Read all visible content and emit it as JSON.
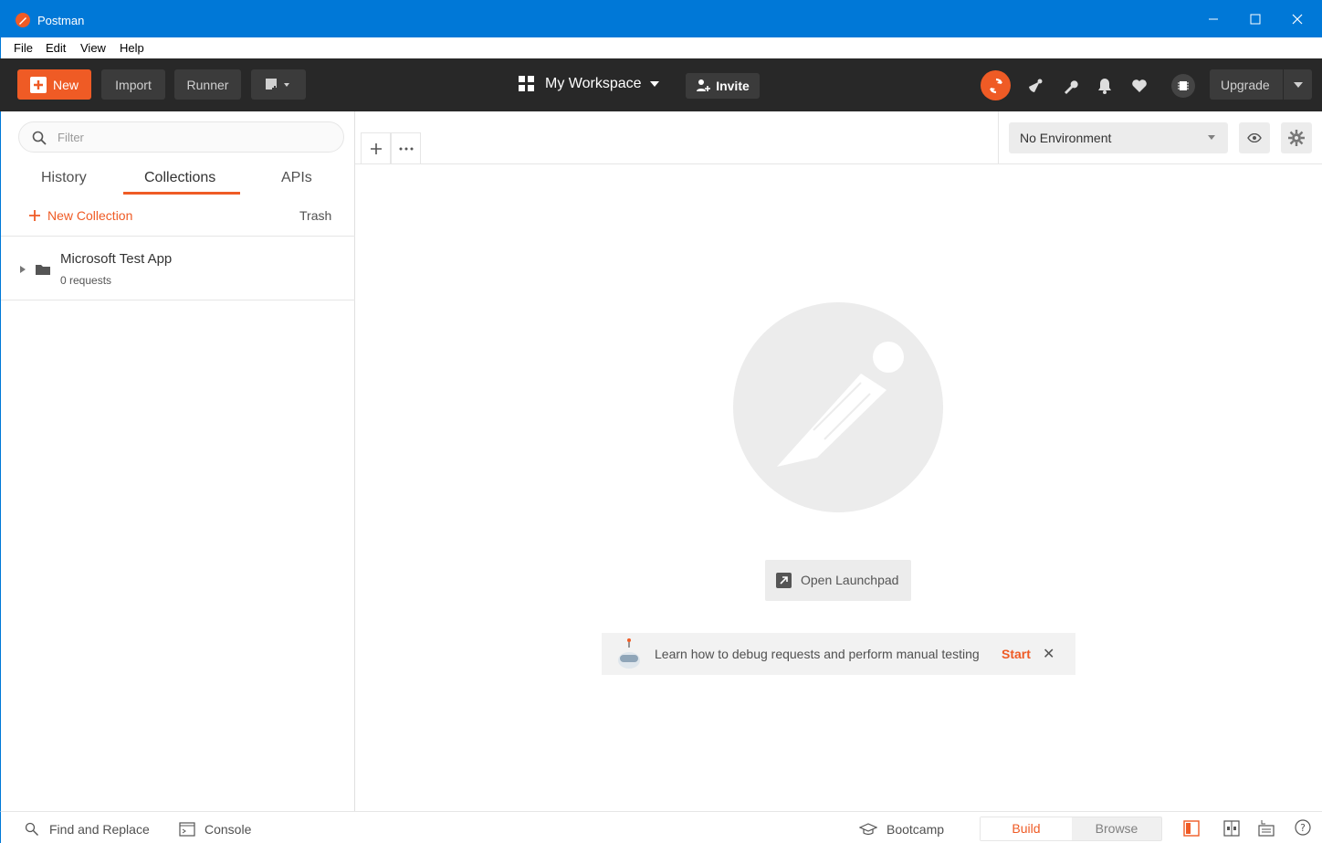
{
  "window": {
    "title": "Postman"
  },
  "menu": [
    "File",
    "Edit",
    "View",
    "Help"
  ],
  "header": {
    "new_label": "New",
    "import_label": "Import",
    "runner_label": "Runner",
    "workspace_label": "My Workspace",
    "invite_label": "Invite",
    "upgrade_label": "Upgrade"
  },
  "sidebar": {
    "filter_placeholder": "Filter",
    "tabs": [
      "History",
      "Collections",
      "APIs"
    ],
    "active_tab": "Collections",
    "new_collection_label": "New Collection",
    "trash_label": "Trash",
    "collections": [
      {
        "name": "Microsoft Test App",
        "count": "0 requests"
      }
    ]
  },
  "environment": {
    "selected": "No Environment"
  },
  "main": {
    "launchpad_label": "Open Launchpad",
    "tip_text": "Learn how to debug requests and perform manual testing",
    "tip_action": "Start"
  },
  "statusbar": {
    "find_replace": "Find and Replace",
    "console": "Console",
    "bootcamp": "Bootcamp",
    "build": "Build",
    "browse": "Browse",
    "active_mode": "Build"
  },
  "colors": {
    "accent": "#ef5b25",
    "titlebar": "#0078d7",
    "header": "#282828"
  }
}
